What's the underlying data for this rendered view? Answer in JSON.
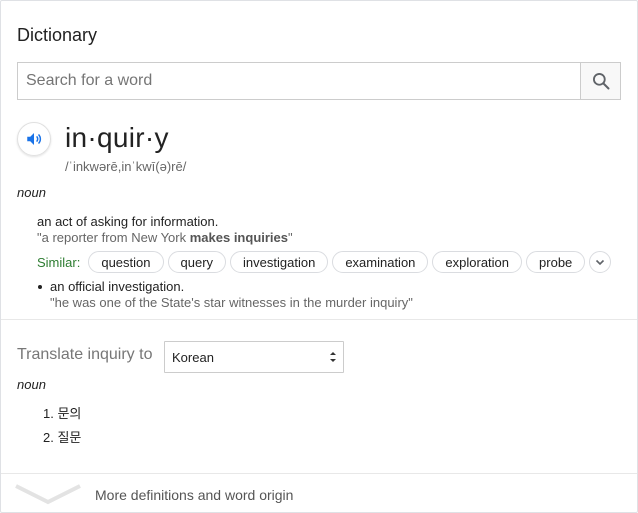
{
  "card": {
    "title": "Dictionary",
    "search": {
      "placeholder": "Search for a word",
      "value": "",
      "button_icon": "search-icon"
    },
    "entry": {
      "word": "in·quir·y",
      "pronunciation": "/ˈinkwərē,inˈkwī(ə)rē/",
      "speaker_icon": "speaker-icon",
      "part_of_speech": "noun",
      "definitions": [
        {
          "text": "an act of asking for information.",
          "example_prefix": "\"a reporter from New York ",
          "example_bold": "makes inquiries",
          "example_suffix": "\""
        },
        {
          "text": "an official investigation.",
          "example": "\"he was one of the State's star witnesses in the murder inquiry\""
        }
      ],
      "similar_label": "Similar:",
      "similar": [
        "question",
        "query",
        "investigation",
        "examination",
        "exploration",
        "probe"
      ],
      "expand_icon": "chevron-down-icon"
    },
    "translate": {
      "label": "Translate inquiry to",
      "language": "Korean",
      "part_of_speech": "noun",
      "items": [
        "1. 문의",
        "2. 질문"
      ]
    },
    "more": {
      "label": "More definitions and word origin",
      "icon": "chevron-down-icon"
    }
  },
  "colors": {
    "similar_label": "#2e7d32",
    "speaker_blue": "#1a73e8",
    "muted_text": "#666666"
  }
}
